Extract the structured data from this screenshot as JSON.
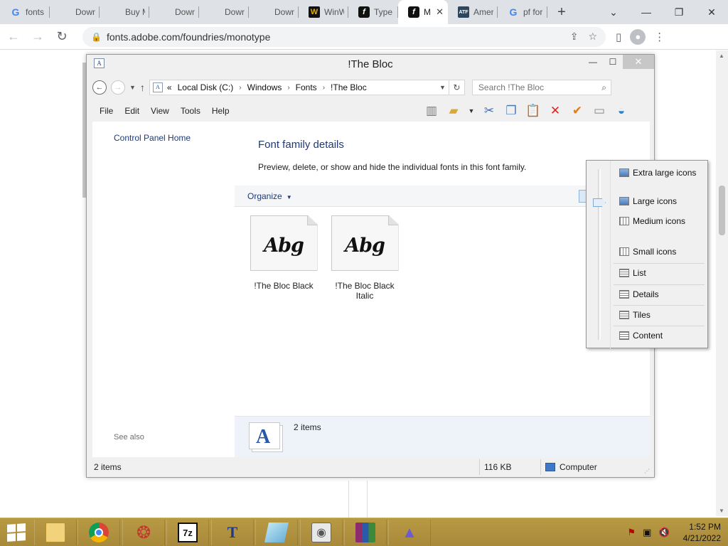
{
  "browser": {
    "tabs": [
      {
        "label": "fonts",
        "favicon": "google-icon",
        "active": false
      },
      {
        "label": "Down",
        "favicon": "microsoft-icon",
        "active": false
      },
      {
        "label": "Buy M",
        "favicon": "microsoft-icon",
        "active": false
      },
      {
        "label": "Down",
        "favicon": "microsoft-icon",
        "active": false
      },
      {
        "label": "Down",
        "favicon": "microsoft-icon",
        "active": false
      },
      {
        "label": "Down",
        "favicon": "microsoft-icon",
        "active": false
      },
      {
        "label": "WinW",
        "favicon": "winworld-icon",
        "active": false
      },
      {
        "label": "Type",
        "favicon": "adobe-fonts-icon",
        "active": false
      },
      {
        "label": "M",
        "favicon": "adobe-fonts-icon",
        "active": true
      },
      {
        "label": "Amer",
        "favicon": "atf-icon",
        "active": false
      },
      {
        "label": "pf for",
        "favicon": "google-icon",
        "active": false
      }
    ],
    "url": "fonts.adobe.com/foundries/monotype"
  },
  "explorer": {
    "title": "!The Bloc",
    "breadcrumb": {
      "prefix": "«",
      "parts": [
        "Local Disk (C:)",
        "Windows",
        "Fonts",
        "!The Bloc"
      ]
    },
    "search_placeholder": "Search !The Bloc",
    "menu": [
      "File",
      "Edit",
      "View",
      "Tools",
      "Help"
    ],
    "nav": {
      "control_panel_home": "Control Panel Home",
      "see_also": "See also"
    },
    "content": {
      "heading": "Font family details",
      "description": "Preview, delete, or show and hide the individual fonts in this font family.",
      "organize": "Organize",
      "fonts": [
        {
          "sample": "Abg",
          "name": "!The Bloc Black"
        },
        {
          "sample": "Abg",
          "name": "!The Bloc Black Italic"
        }
      ],
      "details_count": "2 items"
    },
    "status": {
      "items": "2 items",
      "size": "116 KB",
      "location": "Computer"
    },
    "view_menu": {
      "items": [
        "Extra large icons",
        "Large icons",
        "Medium icons",
        "Small icons",
        "List",
        "Details",
        "Tiles",
        "Content"
      ]
    }
  },
  "taskbar": {
    "time": "1:52 PM",
    "date": "4/21/2022"
  }
}
